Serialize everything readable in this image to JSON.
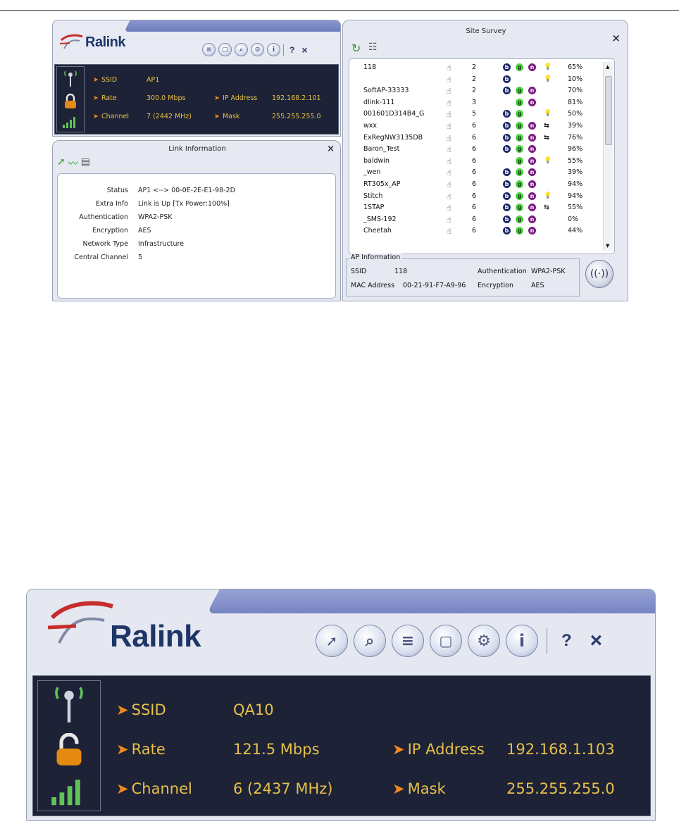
{
  "top": {
    "ralink": {
      "logo_text": "Ralink",
      "help_label": "?",
      "close_label": "×",
      "status": {
        "ssid_label": "SSID",
        "ssid_value": "AP1",
        "rate_label": "Rate",
        "rate_value": "300.0 Mbps",
        "ip_label": "IP Address",
        "ip_value": "192.168.2.101",
        "channel_label": "Channel",
        "channel_value": "7 (2442 MHz)",
        "mask_label": "Mask",
        "mask_value": "255.255.255.0"
      }
    },
    "link_info": {
      "title": "Link Information",
      "close_label": "×",
      "rows": [
        {
          "label": "Status",
          "value": "AP1 <--> 00-0E-2E-E1-98-2D"
        },
        {
          "label": "Extra Info",
          "value": "Link is Up  [Tx Power:100%]"
        },
        {
          "label": "Authentication",
          "value": "WPA2-PSK"
        },
        {
          "label": "Encryption",
          "value": "AES"
        },
        {
          "label": "Network Type",
          "value": "Infrastructure"
        },
        {
          "label": "Central Channel",
          "value": "5"
        }
      ]
    },
    "site_survey": {
      "title": "Site Survey",
      "close_label": "×",
      "rows": [
        {
          "ssid": "118",
          "ch": "2",
          "b": true,
          "g": true,
          "n": true,
          "ico": "bulb",
          "pct": "65%"
        },
        {
          "ssid": "",
          "ch": "2",
          "b": true,
          "g": false,
          "n": false,
          "ico": "bulb",
          "pct": "10%"
        },
        {
          "ssid": "SoftAP-33333",
          "ch": "2",
          "b": true,
          "g": true,
          "n": true,
          "ico": "",
          "pct": "70%"
        },
        {
          "ssid": "dlink-111",
          "ch": "3",
          "b": false,
          "g": true,
          "n": true,
          "ico": "",
          "pct": "81%"
        },
        {
          "ssid": "001601D314B4_G",
          "ch": "5",
          "b": true,
          "g": true,
          "n": false,
          "ico": "bulb",
          "pct": "50%"
        },
        {
          "ssid": "wxx",
          "ch": "6",
          "b": true,
          "g": true,
          "n": true,
          "ico": "wps",
          "pct": "39%"
        },
        {
          "ssid": "ExRegNW3135DB",
          "ch": "6",
          "b": true,
          "g": true,
          "n": true,
          "ico": "wps",
          "pct": "76%"
        },
        {
          "ssid": "Baron_Test",
          "ch": "6",
          "b": true,
          "g": true,
          "n": true,
          "ico": "",
          "pct": "96%"
        },
        {
          "ssid": "baldwin",
          "ch": "6",
          "b": false,
          "g": true,
          "n": true,
          "ico": "bulb",
          "pct": "55%"
        },
        {
          "ssid": "_wen",
          "ch": "6",
          "b": true,
          "g": true,
          "n": true,
          "ico": "",
          "pct": "39%"
        },
        {
          "ssid": "RT305x_AP",
          "ch": "6",
          "b": true,
          "g": true,
          "n": true,
          "ico": "",
          "pct": "94%"
        },
        {
          "ssid": "Stitch",
          "ch": "6",
          "b": true,
          "g": true,
          "n": true,
          "ico": "bulb",
          "pct": "94%"
        },
        {
          "ssid": "1STAP",
          "ch": "6",
          "b": true,
          "g": true,
          "n": true,
          "ico": "wps",
          "pct": "55%"
        },
        {
          "ssid": "_SMS-192",
          "ch": "6",
          "b": true,
          "g": true,
          "n": true,
          "ico": "",
          "pct": "0%"
        },
        {
          "ssid": "Cheetah",
          "ch": "6",
          "b": true,
          "g": true,
          "n": true,
          "ico": "",
          "pct": "44%"
        }
      ],
      "ap_info": {
        "caption": "AP Information",
        "ssid_label": "SSID",
        "ssid_value": "118",
        "auth_label": "Authentication",
        "auth_value": "WPA2-PSK",
        "mac_label": "MAC Address",
        "mac_value": "00-21-91-F7-A9-96",
        "enc_label": "Encryption",
        "enc_value": "AES"
      }
    }
  },
  "bottom": {
    "logo_text": "Ralink",
    "help_label": "?",
    "close_label": "×",
    "status": {
      "ssid_label": "SSID",
      "ssid_value": "QA10",
      "rate_label": "Rate",
      "rate_value": "121.5 Mbps",
      "ip_label": "IP Address",
      "ip_value": "192.168.1.103",
      "channel_label": "Channel",
      "channel_value": "6 (2437 MHz)",
      "mask_label": "Mask",
      "mask_value": "255.255.255.0"
    }
  },
  "icons": {
    "badge_b": "b",
    "badge_g": "g",
    "badge_n": "n",
    "bulb": "💡",
    "wps": "⇆",
    "hand": "☝"
  },
  "colors": {
    "navy_panel": "#1d2236",
    "gold_text": "#e5c04a",
    "orange_arrow": "#f08a1e",
    "signal_green": "#5fc35a"
  }
}
